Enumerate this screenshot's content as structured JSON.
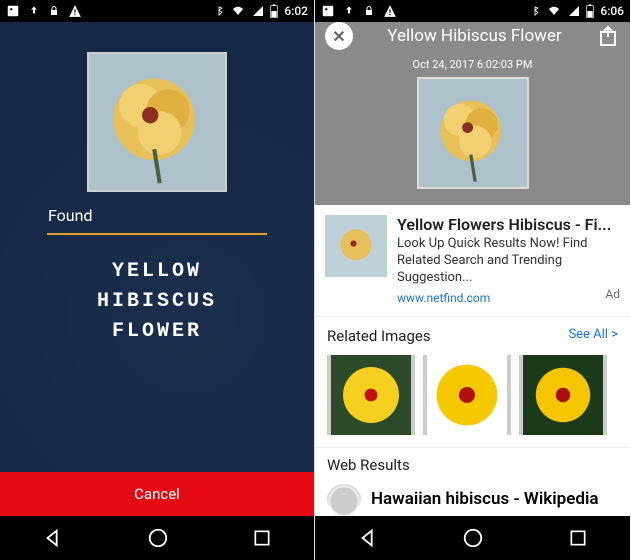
{
  "left": {
    "status_time": "6:02",
    "found_label": "Found",
    "result_line1": "YELLOW",
    "result_line2": "HIBISCUS",
    "result_line3": "FLOWER",
    "cancel_label": "Cancel"
  },
  "right": {
    "status_time": "6:06",
    "header_title": "Yellow Hibiscus Flower",
    "timestamp": "Oct 24, 2017 6:02:03 PM",
    "ad": {
      "title": "Yellow Flowers Hibiscus - Fi...",
      "desc": "Look Up Quick Results Now! Find Related Search and Trending Suggestion...",
      "url": "www.netfind.com",
      "label": "Ad"
    },
    "related": {
      "title": "Related Images",
      "see_all": "See All >"
    },
    "web": {
      "title": "Web Results",
      "item1": "Hawaiian hibiscus - Wikipedia"
    }
  }
}
